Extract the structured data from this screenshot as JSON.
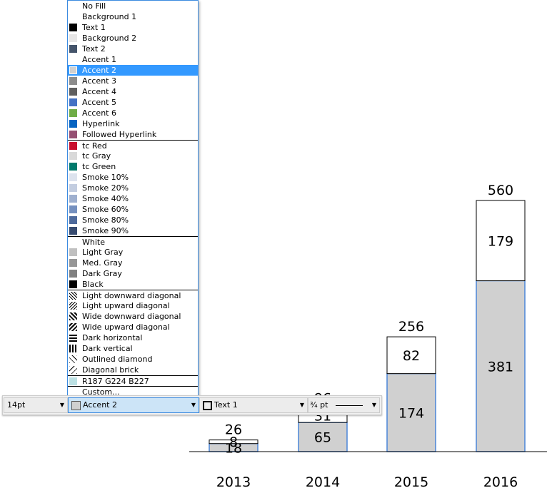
{
  "dropdown": {
    "items": [
      {
        "label": "No Fill",
        "swatch": null
      },
      {
        "label": "Background 1",
        "swatch": null
      },
      {
        "label": "Text 1",
        "swatch": "#000000"
      },
      {
        "label": "Background 2",
        "swatch": "#e7e6e6"
      },
      {
        "label": "Text 2",
        "swatch": "#44546a"
      },
      {
        "label": "Accent 1",
        "swatch": null
      },
      {
        "label": "Accent 2",
        "swatch": "#d0d0d0",
        "selected": true
      },
      {
        "label": "Accent 3",
        "swatch": "#8c8c8c"
      },
      {
        "label": "Accent 4",
        "swatch": "#5f5f5f"
      },
      {
        "label": "Accent 5",
        "swatch": "#4472c4"
      },
      {
        "label": "Accent 6",
        "swatch": "#70ad47"
      },
      {
        "label": "Hyperlink",
        "swatch": "#0563c1"
      },
      {
        "label": "Followed Hyperlink",
        "swatch": "#954f72"
      },
      {
        "label": "tc Red",
        "swatch": "#c8102e",
        "separator": true
      },
      {
        "label": "tc Gray",
        "swatch": "#d9d9d9"
      },
      {
        "label": "tc Green",
        "swatch": "#00796b"
      },
      {
        "label": "Smoke 10%",
        "swatch": "#dde3ee"
      },
      {
        "label": "Smoke 20%",
        "swatch": "#c3cde0"
      },
      {
        "label": "Smoke 40%",
        "swatch": "#9fb0cf"
      },
      {
        "label": "Smoke 60%",
        "swatch": "#7590bf"
      },
      {
        "label": "Smoke 80%",
        "swatch": "#4e6a9c"
      },
      {
        "label": "Smoke 90%",
        "swatch": "#374b70"
      },
      {
        "label": "White",
        "swatch": null,
        "separator": true
      },
      {
        "label": "Light Gray",
        "swatch": "#c0c0c0"
      },
      {
        "label": "Med. Gray",
        "swatch": "#969696"
      },
      {
        "label": "Dark Gray",
        "swatch": "#808080"
      },
      {
        "label": "Black",
        "swatch": "#000000"
      },
      {
        "label": "Light downward diagonal",
        "pattern": "light-down",
        "separator": true
      },
      {
        "label": "Light upward diagonal",
        "pattern": "light-up"
      },
      {
        "label": "Wide downward diagonal",
        "pattern": "wide-down"
      },
      {
        "label": "Wide upward diagonal",
        "pattern": "wide-up"
      },
      {
        "label": "Dark horizontal",
        "pattern": "dark-horizontal"
      },
      {
        "label": "Dark vertical",
        "pattern": "dark-vertical"
      },
      {
        "label": "Outlined diamond",
        "pattern": "outlined-diamond"
      },
      {
        "label": "Diagonal brick",
        "pattern": "diagonal-brick"
      },
      {
        "label": "R187 G224 B227",
        "swatch": "#bbe0e3",
        "separator": true
      },
      {
        "label": "Custom...",
        "swatch": null,
        "separator": true
      }
    ]
  },
  "toolbar": {
    "font_size": "14pt",
    "fill": "Accent 2",
    "fill_color": "#d0d0d0",
    "line": "Text 1",
    "line_color": "#ffffff",
    "weight": "¾ pt"
  },
  "chart_data": {
    "type": "bar",
    "stacked": true,
    "categories": [
      "2013",
      "2014",
      "2015",
      "2016"
    ],
    "series": [
      {
        "values": [
          18,
          65,
          174,
          381
        ],
        "color": "#d0d0d0"
      },
      {
        "values": [
          8,
          31,
          82,
          179
        ],
        "color": "#ffffff"
      }
    ],
    "totals": [
      26,
      96,
      256,
      560
    ],
    "ylim": [
      0,
      560
    ],
    "grid": false
  }
}
